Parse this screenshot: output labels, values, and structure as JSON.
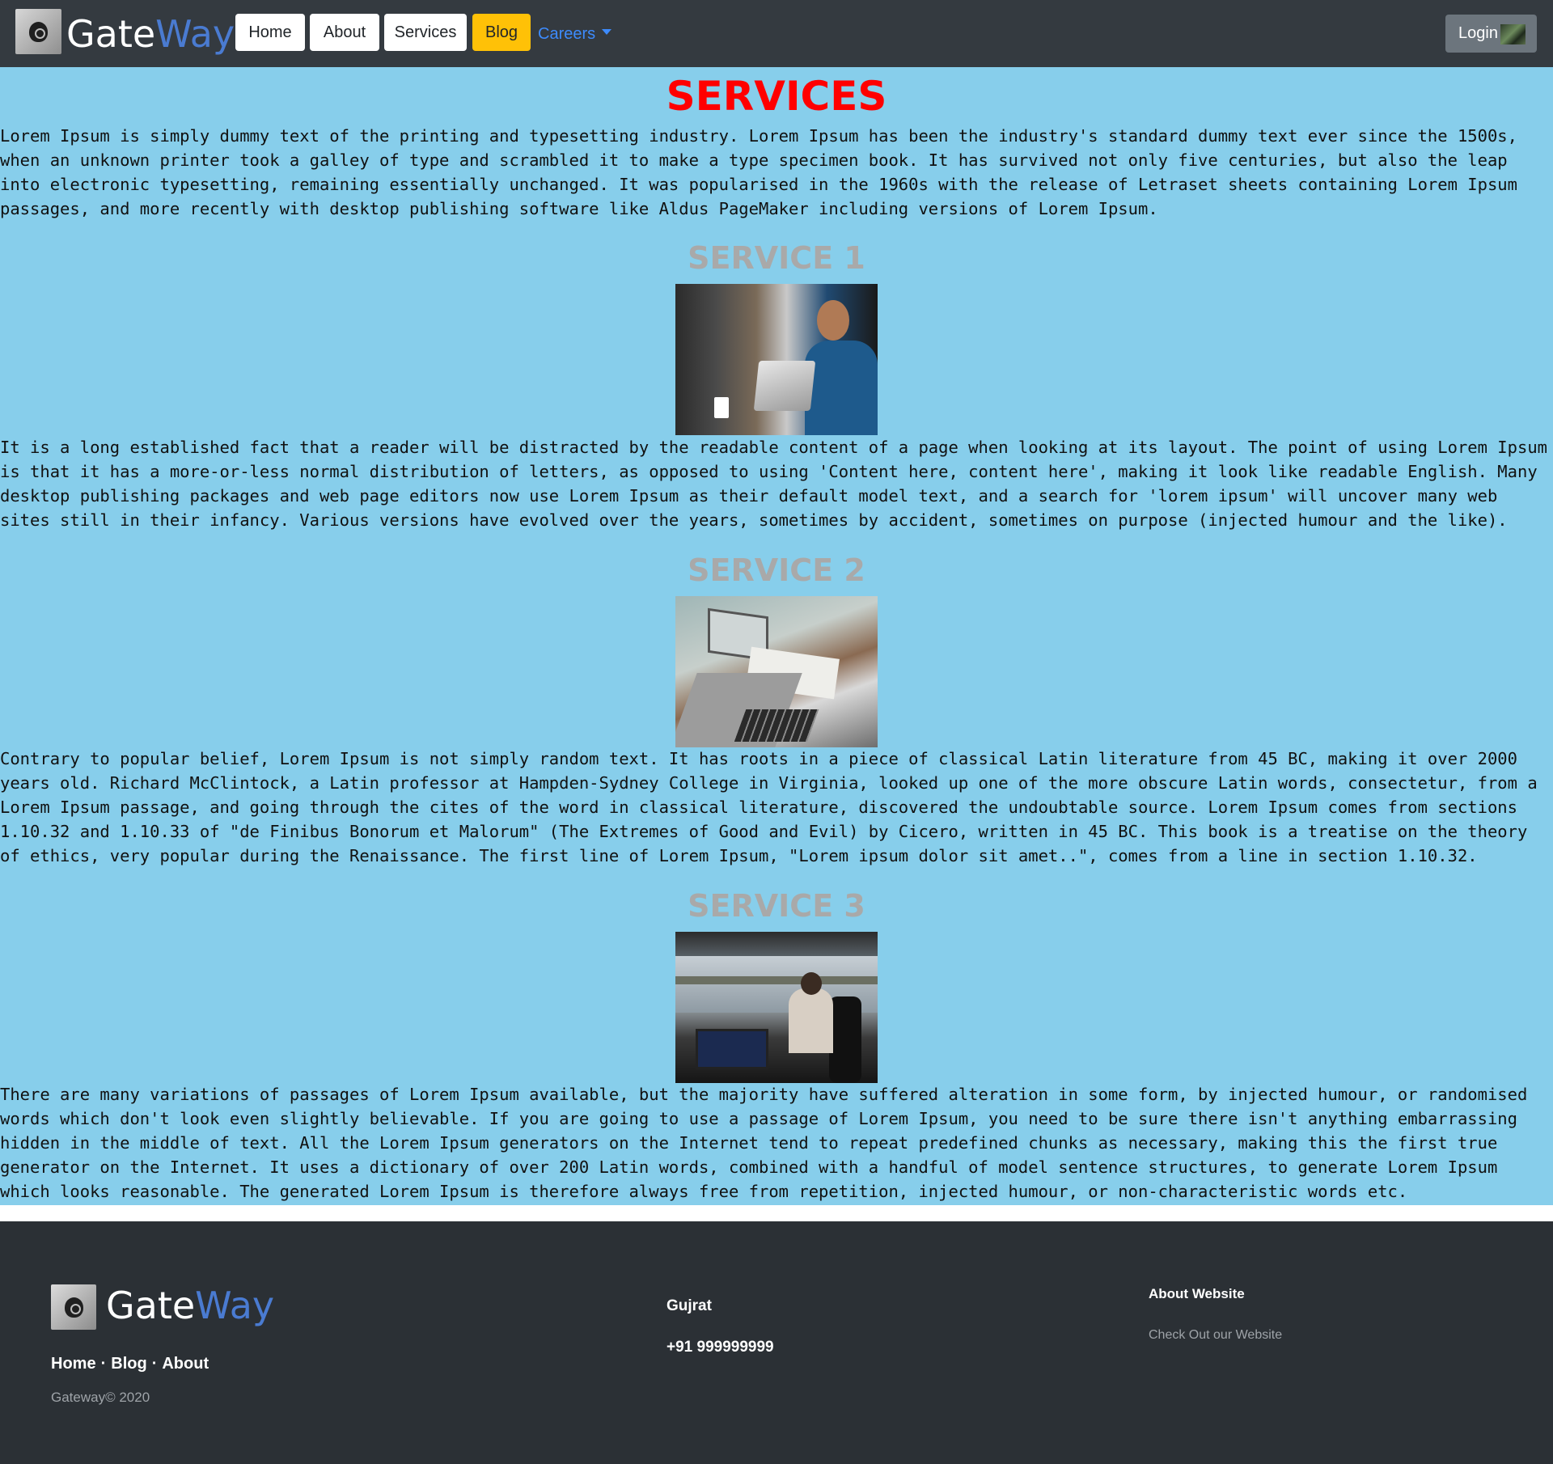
{
  "navbar": {
    "brand_gate": "Gate",
    "brand_way": "Way",
    "home": "Home",
    "about": "About",
    "services": "Services",
    "blog": "Blog",
    "careers": "Careers",
    "login": "Login"
  },
  "main": {
    "title": "SERVICES",
    "intro": "Lorem Ipsum is simply dummy text of the printing and typesetting industry. Lorem Ipsum has been the industry's standard dummy text ever since the 1500s, when an unknown printer took a galley of type and scrambled it to make a type specimen book. It has survived not only five centuries, but also the leap into electronic typesetting, remaining essentially unchanged. It was popularised in the 1960s with the release of Letraset sheets containing Lorem Ipsum passages, and more recently with desktop publishing software like Aldus PageMaker including versions of Lorem Ipsum.",
    "services": [
      {
        "title": "SERVICE 1",
        "text": "It is a long established fact that a reader will be distracted by the readable content of a page when looking at its layout. The point of using Lorem Ipsum is that it has a more-or-less normal distribution of letters, as opposed to using 'Content here, content here', making it look like readable English. Many desktop publishing packages and web page editors now use Lorem Ipsum as their default model text, and a search for 'lorem ipsum' will uncover many web sites still in their infancy. Various versions have evolved over the years, sometimes by accident, sometimes on purpose (injected humour and the like)."
      },
      {
        "title": "SERVICE 2",
        "text": "Contrary to popular belief, Lorem Ipsum is not simply random text. It has roots in a piece of classical Latin literature from 45 BC, making it over 2000 years old. Richard McClintock, a Latin professor at Hampden-Sydney College in Virginia, looked up one of the more obscure Latin words, consectetur, from a Lorem Ipsum passage, and going through the cites of the word in classical literature, discovered the undoubtable source. Lorem Ipsum comes from sections 1.10.32 and 1.10.33 of \"de Finibus Bonorum et Malorum\" (The Extremes of Good and Evil) by Cicero, written in 45 BC. This book is a treatise on the theory of ethics, very popular during the Renaissance. The first line of Lorem Ipsum, \"Lorem ipsum dolor sit amet..\", comes from a line in section 1.10.32."
      },
      {
        "title": "SERVICE 3",
        "text": "There are many variations of passages of Lorem Ipsum available, but the majority have suffered alteration in some form, by injected humour, or randomised words which don't look even slightly believable. If you are going to use a passage of Lorem Ipsum, you need to be sure there isn't anything embarrassing hidden in the middle of text. All the Lorem Ipsum generators on the Internet tend to repeat predefined chunks as necessary, making this the first true generator on the Internet. It uses a dictionary of over 200 Latin words, combined with a handful of model sentence structures, to generate Lorem Ipsum which looks reasonable. The generated Lorem Ipsum is therefore always free from repetition, injected humour, or non-characteristic words etc."
      }
    ]
  },
  "footer": {
    "brand_gate": "Gate",
    "brand_way": "Way",
    "links": [
      "Home",
      "Blog",
      "About"
    ],
    "separator": "·",
    "copyright": "Gateway© 2020",
    "city": "Gujrat",
    "phone": "+91 999999999",
    "about_heading": "About Website",
    "about_link": "Check Out our Website"
  },
  "colors": {
    "navbar_bg": "#343a40",
    "main_bg": "#87ceeb",
    "title_red": "#ff0000",
    "service_title": "#a9a9a9",
    "blog_yellow": "#ffc107",
    "careers_blue": "#3d8bfd",
    "footer_bg": "#2b3035",
    "brand_way_blue": "#4a7bd1"
  },
  "icons": [
    "gateway-logo-icon",
    "login-avatar-icon",
    "chevron-down-icon"
  ]
}
